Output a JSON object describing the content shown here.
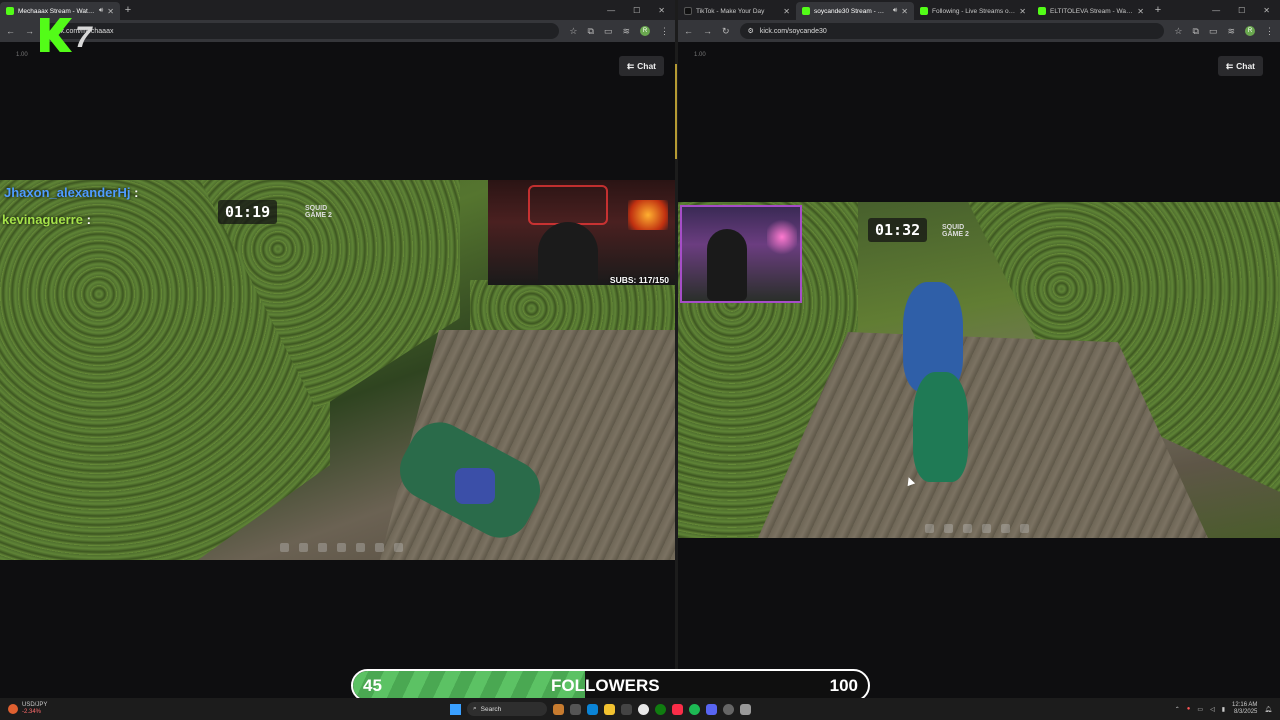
{
  "left_window": {
    "tabs": [
      {
        "title": "Mechaaax Stream - Watch Live",
        "active": true,
        "audio": true
      }
    ],
    "url": "kick.com/mechaaax",
    "volume_label": "1.00",
    "chat_button": "Chat",
    "stream": {
      "timer": "01:19",
      "game_logo": "SQUID GAME 2",
      "subs": "SUBS: 117/150",
      "chat_lines": [
        {
          "user": "Jhaxon_alexanderHj",
          "sep": ":",
          "color": "#4f9cff"
        },
        {
          "user": "kevinaguerre",
          "sep": ":",
          "color": "#a6e34a"
        }
      ]
    }
  },
  "right_window": {
    "tabs": [
      {
        "title": "TikTok - Make Your Day",
        "active": false
      },
      {
        "title": "soycande30 Stream - Watch Live",
        "active": true,
        "audio": true
      },
      {
        "title": "Following - Live Streams on Kick",
        "active": false
      },
      {
        "title": "ELTITOLEVA Stream - Watch Live",
        "active": false
      }
    ],
    "url": "kick.com/soycande30",
    "volume_label": "1.00",
    "chat_button": "Chat",
    "stream": {
      "timer": "01:32",
      "game_logo": "SQUID GAME 2"
    }
  },
  "overlay": {
    "logo_number": "7",
    "followers_bar": {
      "current": "45",
      "label": "FOLLOWERS",
      "goal": "100",
      "fill_fraction": 0.45
    }
  },
  "taskbar": {
    "ticker_name": "USD/JPY",
    "ticker_change": "-2.34%",
    "search_placeholder": "Search",
    "time": "12:16 AM",
    "date": "8/3/2025"
  },
  "colors": {
    "kick_green": "#53fc18",
    "followers_fill": "#5cc264"
  }
}
